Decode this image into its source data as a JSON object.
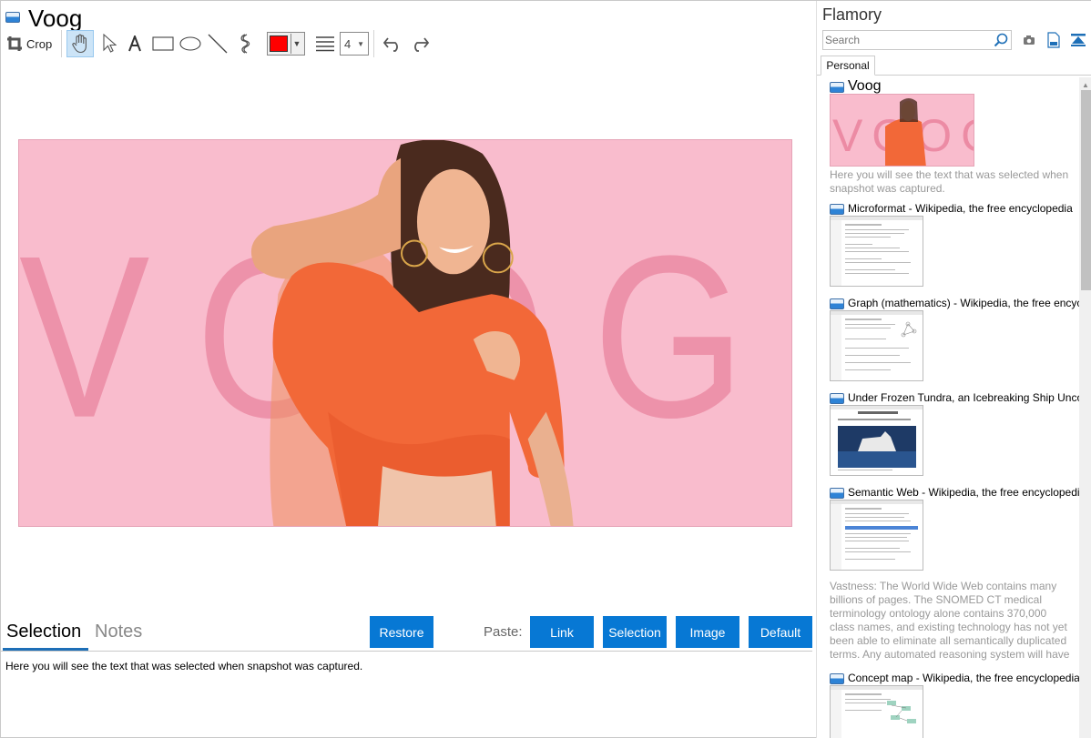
{
  "document": {
    "title": "Voog",
    "icon": "flamory-snapshot-icon"
  },
  "toolbar": {
    "crop_label": "Crop",
    "tools": [
      "crop-icon",
      "hand-icon",
      "pointer-icon",
      "text-icon",
      "rectangle-icon",
      "ellipse-icon",
      "line-icon",
      "freehand-icon"
    ],
    "stroke_color": "#ff0000",
    "line_width": "4"
  },
  "snapshot": {
    "background_text": "VOOG",
    "background_color": "#f9bccd"
  },
  "bottom": {
    "tabs": {
      "selection": "Selection",
      "notes": "Notes"
    },
    "restore_label": "Restore",
    "paste_label": "Paste:",
    "paste_buttons": {
      "link": "Link",
      "selection": "Selection",
      "image": "Image",
      "default": "Default"
    },
    "selection_text": "Here you will see the text that was selected when snapshot was captured."
  },
  "sidebar": {
    "app_name": "Flamory",
    "search_placeholder": "Search",
    "tab": "Personal",
    "items": [
      {
        "title": "Voog",
        "desc": "Here you will see the text that was selected when snapshot was captured."
      },
      {
        "title": "Microformat - Wikipedia, the free encyclopedia"
      },
      {
        "title": "Graph (mathematics) - Wikipedia, the free encyclopedia"
      },
      {
        "title": "Under Frozen Tundra, an Icebreaking Ship Uncovers"
      },
      {
        "title": "Semantic Web - Wikipedia, the free encyclopedia",
        "desc": "Vastness: The World Wide Web contains many billions of pages. The SNOMED CT medical terminology ontology alone contains 370,000 class names, and existing technology has not yet been able to eliminate all semantically duplicated terms. Any automated reasoning system will have to deal with truly huge inputs."
      },
      {
        "title": "Concept map - Wikipedia, the free encyclopedia"
      }
    ]
  },
  "colors": {
    "accent": "#0778d4",
    "tab_underline": "#1e6fb7"
  }
}
